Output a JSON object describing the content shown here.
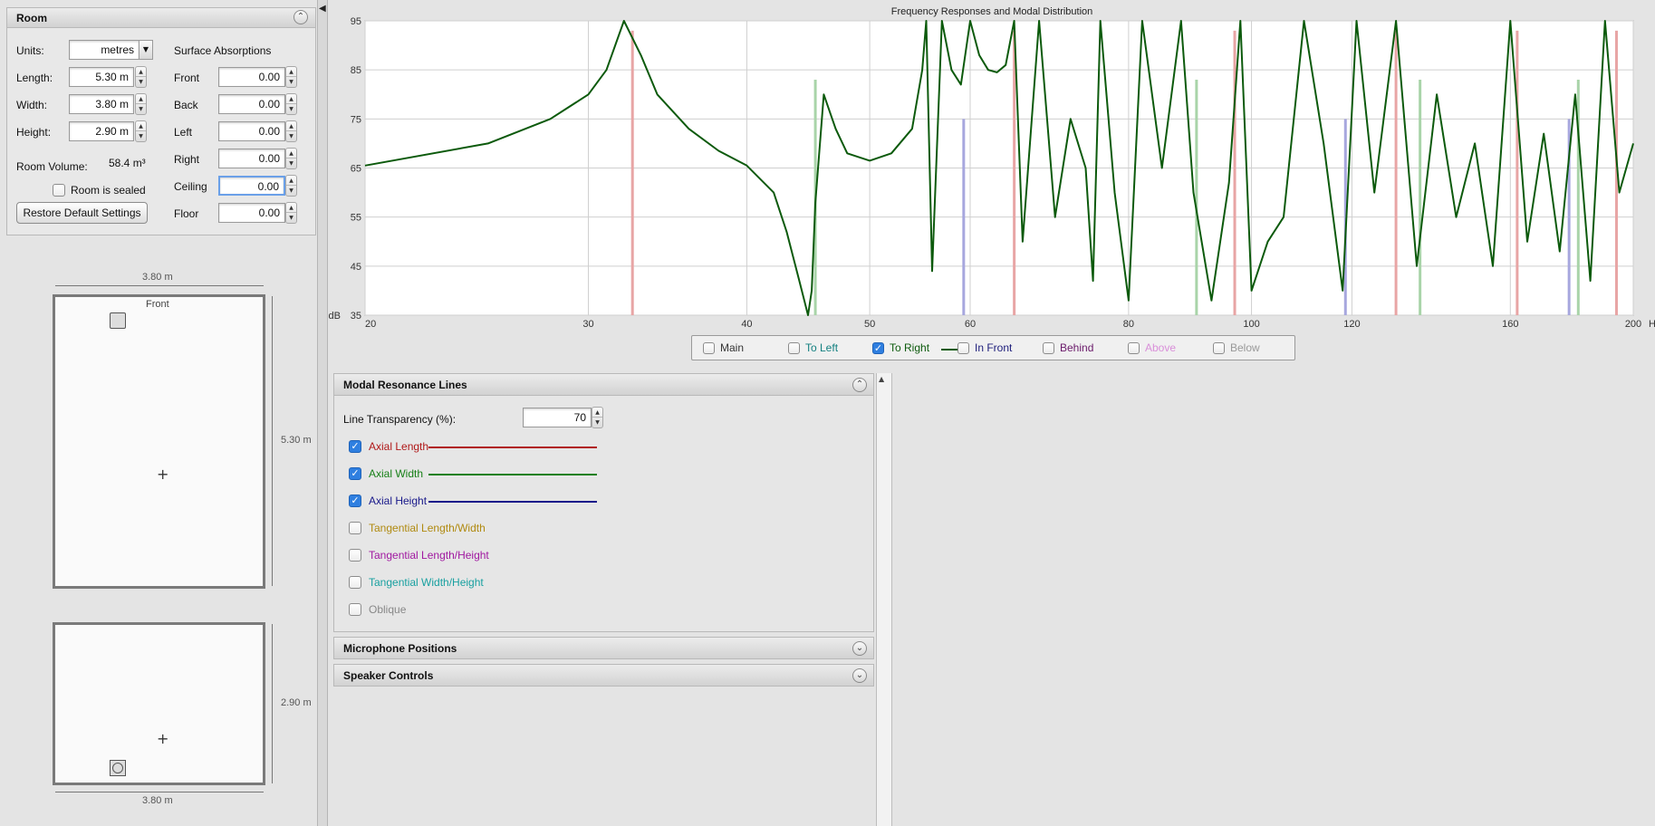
{
  "room": {
    "title": "Room",
    "units_label": "Units:",
    "units_value": "metres",
    "length_label": "Length:",
    "length_value": "5.30 m",
    "width_label": "Width:",
    "width_value": "3.80 m",
    "height_label": "Height:",
    "height_value": "2.90 m",
    "volume_label": "Room Volume:",
    "volume_value": "58.4 m³",
    "sealed_label": "Room is sealed",
    "restore_label": "Restore Default Settings",
    "absorptions_title": "Surface Absorptions",
    "absorptions": [
      {
        "label": "Front",
        "value": "0.00"
      },
      {
        "label": "Back",
        "value": "0.00"
      },
      {
        "label": "Left",
        "value": "0.00"
      },
      {
        "label": "Right",
        "value": "0.00"
      },
      {
        "label": "Ceiling",
        "value": "0.00"
      },
      {
        "label": "Floor",
        "value": "0.00"
      }
    ]
  },
  "plan_view": {
    "width_dim": "3.80 m",
    "length_dim": "5.30 m",
    "front_label": "Front"
  },
  "side_view": {
    "height_dim": "2.90 m",
    "width_dim": "3.80 m"
  },
  "chart_data": {
    "type": "line",
    "title": "Frequency Responses and Modal Distribution",
    "x_unit": "Hz",
    "y_unit": "dB",
    "x_scale": "log",
    "xlim": [
      20,
      200
    ],
    "ylim": [
      35,
      95
    ],
    "x_ticks": [
      20,
      30,
      40,
      50,
      60,
      80,
      100,
      120,
      160,
      200
    ],
    "y_ticks": [
      35,
      45,
      55,
      65,
      75,
      85,
      95
    ],
    "grid": true,
    "series": [
      {
        "name": "To Right",
        "color": "#0c5a0c",
        "x": [
          20,
          25,
          28,
          30,
          31,
          32,
          33,
          34,
          36,
          38,
          40,
          42,
          43,
          44,
          44.7,
          45,
          45.3,
          46,
          47,
          48,
          50,
          52,
          54,
          55,
          55.4,
          56,
          57,
          58,
          59,
          60,
          61,
          62,
          63,
          64,
          65,
          66,
          68,
          70,
          72,
          74,
          75,
          76,
          78,
          80,
          82,
          85,
          88,
          90,
          93,
          96,
          98,
          100,
          103,
          106,
          110,
          114,
          118,
          121,
          125,
          130,
          135,
          140,
          145,
          150,
          155,
          160,
          165,
          170,
          175,
          180,
          185,
          190,
          195,
          200
        ],
        "values": [
          65.5,
          70,
          75,
          80,
          85,
          95,
          88,
          80,
          73,
          68.5,
          65.5,
          60,
          52,
          42,
          35,
          40,
          58,
          80,
          73,
          68,
          66.5,
          68,
          73,
          85,
          95,
          44,
          95,
          85,
          82,
          95,
          88,
          85,
          84.5,
          86,
          95,
          50,
          95,
          55,
          75,
          65,
          42,
          95,
          60,
          38,
          95,
          65,
          95,
          60,
          38,
          62,
          95,
          40,
          50,
          55,
          95,
          70,
          40,
          95,
          60,
          95,
          45,
          80,
          55,
          70,
          45,
          95,
          50,
          72,
          48,
          80,
          42,
          95,
          60,
          70
        ]
      }
    ],
    "modal_lines": [
      {
        "type": "Axial Length",
        "color": "#e8a5a5",
        "frequencies": [
          32.5,
          65,
          97,
          130,
          162,
          194
        ],
        "level_db": 93
      },
      {
        "type": "Axial Width",
        "color": "#a9d4a9",
        "frequencies": [
          45.3,
          90.5,
          135.8,
          181
        ],
        "level_db": 83
      },
      {
        "type": "Axial Height",
        "color": "#a7a7de",
        "frequencies": [
          59.3,
          118.6,
          178
        ],
        "level_db": 75
      }
    ]
  },
  "legend": {
    "items": [
      {
        "label": "Main",
        "color": "#333333",
        "checked": false
      },
      {
        "label": "To Left",
        "color": "#138080",
        "checked": false
      },
      {
        "label": "To Right",
        "color": "#0c5a0c",
        "checked": true
      },
      {
        "label": "In Front",
        "color": "#1c1c7a",
        "checked": false
      },
      {
        "label": "Behind",
        "color": "#6a1a6a",
        "checked": false
      },
      {
        "label": "Above",
        "color": "#d98fd9",
        "checked": false
      },
      {
        "label": "Below",
        "color": "#999999",
        "checked": false
      }
    ]
  },
  "modal_panel": {
    "title": "Modal Resonance Lines",
    "transparency_label": "Line Transparency (%):",
    "transparency_value": "70",
    "rows": [
      {
        "label": "Axial Length",
        "color": "#b01818",
        "checked": true,
        "line": true
      },
      {
        "label": "Axial Width",
        "color": "#188018",
        "checked": true,
        "line": true
      },
      {
        "label": "Axial Height",
        "color": "#18188a",
        "checked": true,
        "line": true
      },
      {
        "label": "Tangential Length/Width",
        "color": "#b08a10",
        "checked": false,
        "line": false
      },
      {
        "label": "Tangential Length/Height",
        "color": "#a018a0",
        "checked": false,
        "line": false
      },
      {
        "label": "Tangential Width/Height",
        "color": "#18a0a0",
        "checked": false,
        "line": false
      },
      {
        "label": "Oblique",
        "color": "#888888",
        "checked": false,
        "line": false
      }
    ]
  },
  "mic_panel": {
    "title": "Microphone Positions"
  },
  "speaker_panel": {
    "title": "Speaker Controls"
  }
}
